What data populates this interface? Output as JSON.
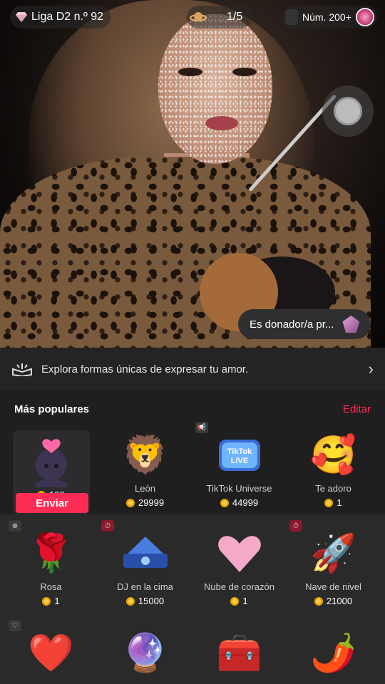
{
  "header": {
    "league": "Liga D2 n.º 92",
    "pager": "1/5",
    "viewers": "Núm. 200+"
  },
  "overlay": {
    "donor_text": "Es donador/a pr..."
  },
  "explore": {
    "text": "Explora formas únicas de expresar tu amor."
  },
  "gifts_section": {
    "title": "Más populares",
    "edit_label": "Editar",
    "send_label": "Enviar"
  },
  "gifts_row1": [
    {
      "name": "",
      "price": "199",
      "icon": "avatar-heart-gift-icon"
    },
    {
      "name": "León",
      "price": "29999",
      "icon": "lion-icon"
    },
    {
      "name": "TikTok Universe",
      "price": "44999",
      "icon": "tiktok-universe-icon"
    },
    {
      "name": "Te adoro",
      "price": "1",
      "icon": "hug-heart-emoji-icon"
    }
  ],
  "gifts_row2": [
    {
      "name": "Rosa",
      "price": "1",
      "icon": "rose-icon"
    },
    {
      "name": "DJ en la cima",
      "price": "15000",
      "icon": "dj-stage-icon"
    },
    {
      "name": "Nube de corazón",
      "price": "1",
      "icon": "heart-cloud-icon"
    },
    {
      "name": "Nave de nivel",
      "price": "21000",
      "icon": "spaceship-icon"
    }
  ],
  "gifts_row3": [
    {
      "icon": "crowned-heart-icon"
    },
    {
      "icon": "magic-scroll-orb-icon"
    },
    {
      "icon": "treasure-chest-icon"
    },
    {
      "icon": "chili-pepper-icon"
    }
  ],
  "colors": {
    "accent": "#ff2c55",
    "sheet_bg": "#1f1f1f",
    "coin": "#f5b800"
  }
}
